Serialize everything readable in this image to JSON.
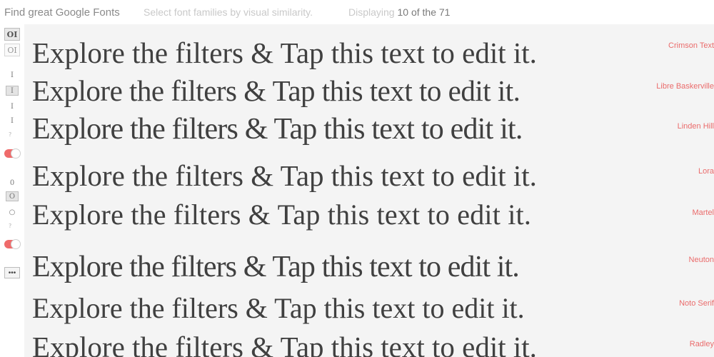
{
  "header": {
    "title": "Find great Google Fonts",
    "subtitle": "Select font families by visual similarity.",
    "displaying_prefix": "Displaying",
    "count_text": "10 of the 71"
  },
  "sidebar": {
    "contrast_high_label": "OI",
    "contrast_low_label": "OI",
    "more_label": "•••"
  },
  "sample_text": "Explore the filters & Tap this text to edit it.",
  "fonts": [
    {
      "name": "Crimson Text"
    },
    {
      "name": "Libre Baskerville"
    },
    {
      "name": "Linden Hill"
    },
    {
      "name": "Lora"
    },
    {
      "name": "Martel"
    },
    {
      "name": "Neuton"
    },
    {
      "name": "Noto Serif"
    },
    {
      "name": "Radley"
    }
  ],
  "colors": {
    "accent": "#ef6b6b",
    "text": "#404040",
    "background": "#f4f4f4"
  }
}
